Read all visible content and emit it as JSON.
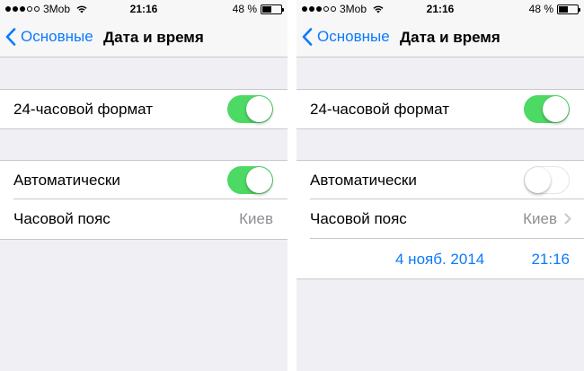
{
  "screens": [
    {
      "status": {
        "carrier": "3Mob",
        "time": "21:16",
        "battery": "48 %",
        "battery_level": 0.48
      },
      "nav": {
        "back_label": "Основные",
        "title": "Дата и время"
      },
      "format_24h": {
        "label": "24-часовой формат",
        "on": true
      },
      "auto": {
        "label": "Автоматически",
        "on": true
      },
      "timezone": {
        "label": "Часовой пояс",
        "value": "Киев"
      }
    },
    {
      "status": {
        "carrier": "3Mob",
        "time": "21:16",
        "battery": "48 %",
        "battery_level": 0.48
      },
      "nav": {
        "back_label": "Основные",
        "title": "Дата и время"
      },
      "format_24h": {
        "label": "24-часовой формат",
        "on": true
      },
      "auto": {
        "label": "Автоматически",
        "on": false
      },
      "timezone": {
        "label": "Часовой пояс",
        "value": "Киев"
      },
      "datetime": {
        "date": "4 нояб. 2014",
        "time": "21:16"
      }
    }
  ],
  "colors": {
    "accent": "#0a7aff",
    "toggle_on": "#4cd964",
    "background": "#efeff4"
  },
  "icons": {
    "back": "chevron-left-icon",
    "wifi": "wifi-icon",
    "battery": "battery-icon",
    "disclosure": "chevron-right-icon"
  }
}
